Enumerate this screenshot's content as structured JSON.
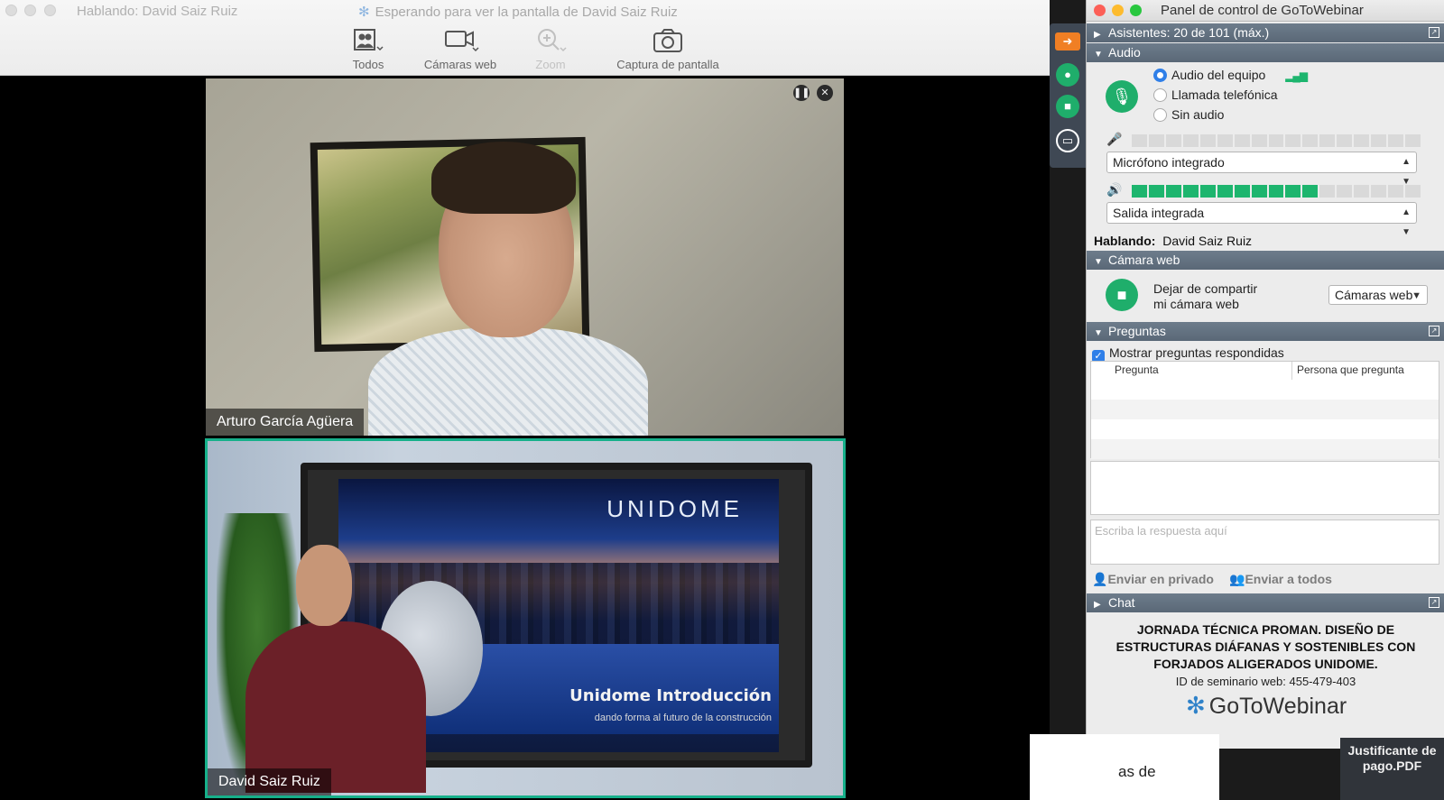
{
  "viewer": {
    "speaking": "Hablando: David Saiz Ruiz",
    "waiting": "Esperando para ver la pantalla de David Saiz Ruiz",
    "toolbar": {
      "todos": "Todos",
      "camaras": "Cámaras web",
      "zoom": "Zoom",
      "captura": "Captura de pantalla"
    },
    "tiles": [
      {
        "name": "Arturo García Agüera"
      },
      {
        "name": "David Saiz Ruiz"
      }
    ],
    "slide": {
      "logo": "UNIDOME",
      "title": "Unidome Introducción",
      "subtitle": "dando forma al futuro de la construcción"
    }
  },
  "panel": {
    "title": "Panel de control de GoToWebinar",
    "asistentes": "Asistentes: 20 de 101 (máx.)",
    "audio": {
      "heading": "Audio",
      "options": [
        "Audio del equipo",
        "Llamada telefónica",
        "Sin audio"
      ],
      "selected_index": 0,
      "mic_level": 0,
      "speaker_level": 0.65,
      "mic_device": "Micrófono integrado",
      "output_device": "Salida integrada",
      "speaking_label": "Hablando:",
      "speaking_name": "David Saiz Ruiz"
    },
    "webcam": {
      "heading": "Cámara web",
      "action_line1": "Dejar de compartir",
      "action_line2": "mi cámara web",
      "select": "Cámaras web"
    },
    "questions": {
      "heading": "Preguntas",
      "show_answered": "Mostrar preguntas respondidas",
      "col_question": "Pregunta",
      "col_person": "Persona que pregunta",
      "reply_placeholder": "Escriba la respuesta aquí",
      "send_private": "Enviar en privado",
      "send_all": "Enviar a todos"
    },
    "chat": {
      "heading": "Chat"
    },
    "webinar_title": "JORNADA TÉCNICA PROMAN. DISEÑO DE ESTRUCTURAS DIÁFANAS Y SOSTENIBLES CON FORJADOS ALIGERADOS UNIDOME.",
    "webinar_id": "ID de seminario web: 455-479-403",
    "brand": "GoToWebinar"
  },
  "desktop": {
    "doc_text": "as de",
    "file_label": "Justificante de pago.PDF"
  },
  "colors": {
    "accent_green": "#1fae6b",
    "tile_active_border": "#16b08a",
    "section_header": "#5f6e7d",
    "radio_selected": "#2f7fe8"
  }
}
